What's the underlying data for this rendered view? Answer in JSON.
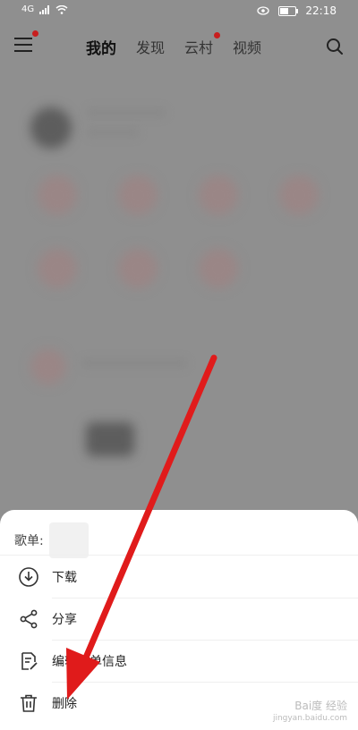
{
  "status_bar": {
    "signal": "4G",
    "time": "22:18"
  },
  "nav": {
    "tabs": [
      {
        "label": "我的",
        "active": true
      },
      {
        "label": "发现",
        "active": false
      },
      {
        "label": "云村",
        "active": false,
        "badge": true
      },
      {
        "label": "视频",
        "active": false
      }
    ]
  },
  "sheet": {
    "title_prefix": "歌单:",
    "actions": [
      {
        "label": "下载",
        "icon": "download-icon"
      },
      {
        "label": "分享",
        "icon": "share-icon"
      },
      {
        "label": "编辑歌单信息",
        "icon": "edit-icon"
      },
      {
        "label": "删除",
        "icon": "trash-icon"
      }
    ]
  },
  "watermark": {
    "line1": "Bai度 经验",
    "line2": "jingyan.baidu.com"
  },
  "colors": {
    "accent": "#c81e1e",
    "arrow": "#e01b1b"
  }
}
